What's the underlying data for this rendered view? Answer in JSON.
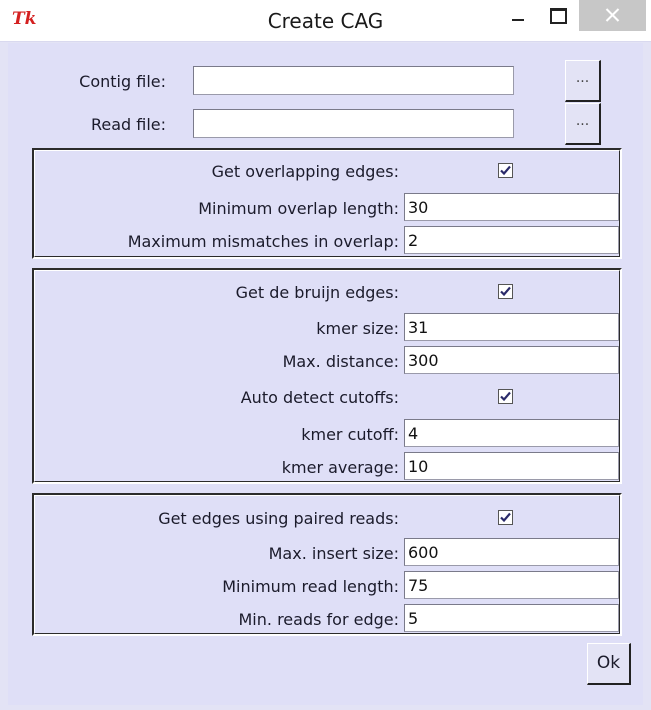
{
  "window": {
    "title": "Create CAG",
    "logo": "Tk"
  },
  "files": {
    "contig_label": "Contig file:",
    "contig_value": "",
    "read_label": "Read file:",
    "read_value": "",
    "browse_label": "..."
  },
  "overlap": {
    "enable_label": "Get overlapping edges:",
    "enabled": true,
    "min_overlap_label": "Minimum overlap length:",
    "min_overlap_value": "30",
    "max_mismatch_label": "Maximum mismatches in overlap:",
    "max_mismatch_value": "2"
  },
  "debruijn": {
    "enable_label": "Get de bruijn edges:",
    "enabled": true,
    "kmer_size_label": "kmer size:",
    "kmer_size_value": "31",
    "max_distance_label": "Max. distance:",
    "max_distance_value": "300",
    "auto_detect_label": "Auto detect cutoffs:",
    "auto_detect": true,
    "kmer_cutoff_label": "kmer cutoff:",
    "kmer_cutoff_value": "4",
    "kmer_average_label": "kmer average:",
    "kmer_average_value": "10"
  },
  "paired": {
    "enable_label": "Get edges using paired reads:",
    "enabled": true,
    "max_insert_label": "Max. insert size:",
    "max_insert_value": "600",
    "min_read_len_label": "Minimum read length:",
    "min_read_len_value": "75",
    "min_reads_label": "Min. reads for edge:",
    "min_reads_value": "5"
  },
  "ok_label": "Ok"
}
